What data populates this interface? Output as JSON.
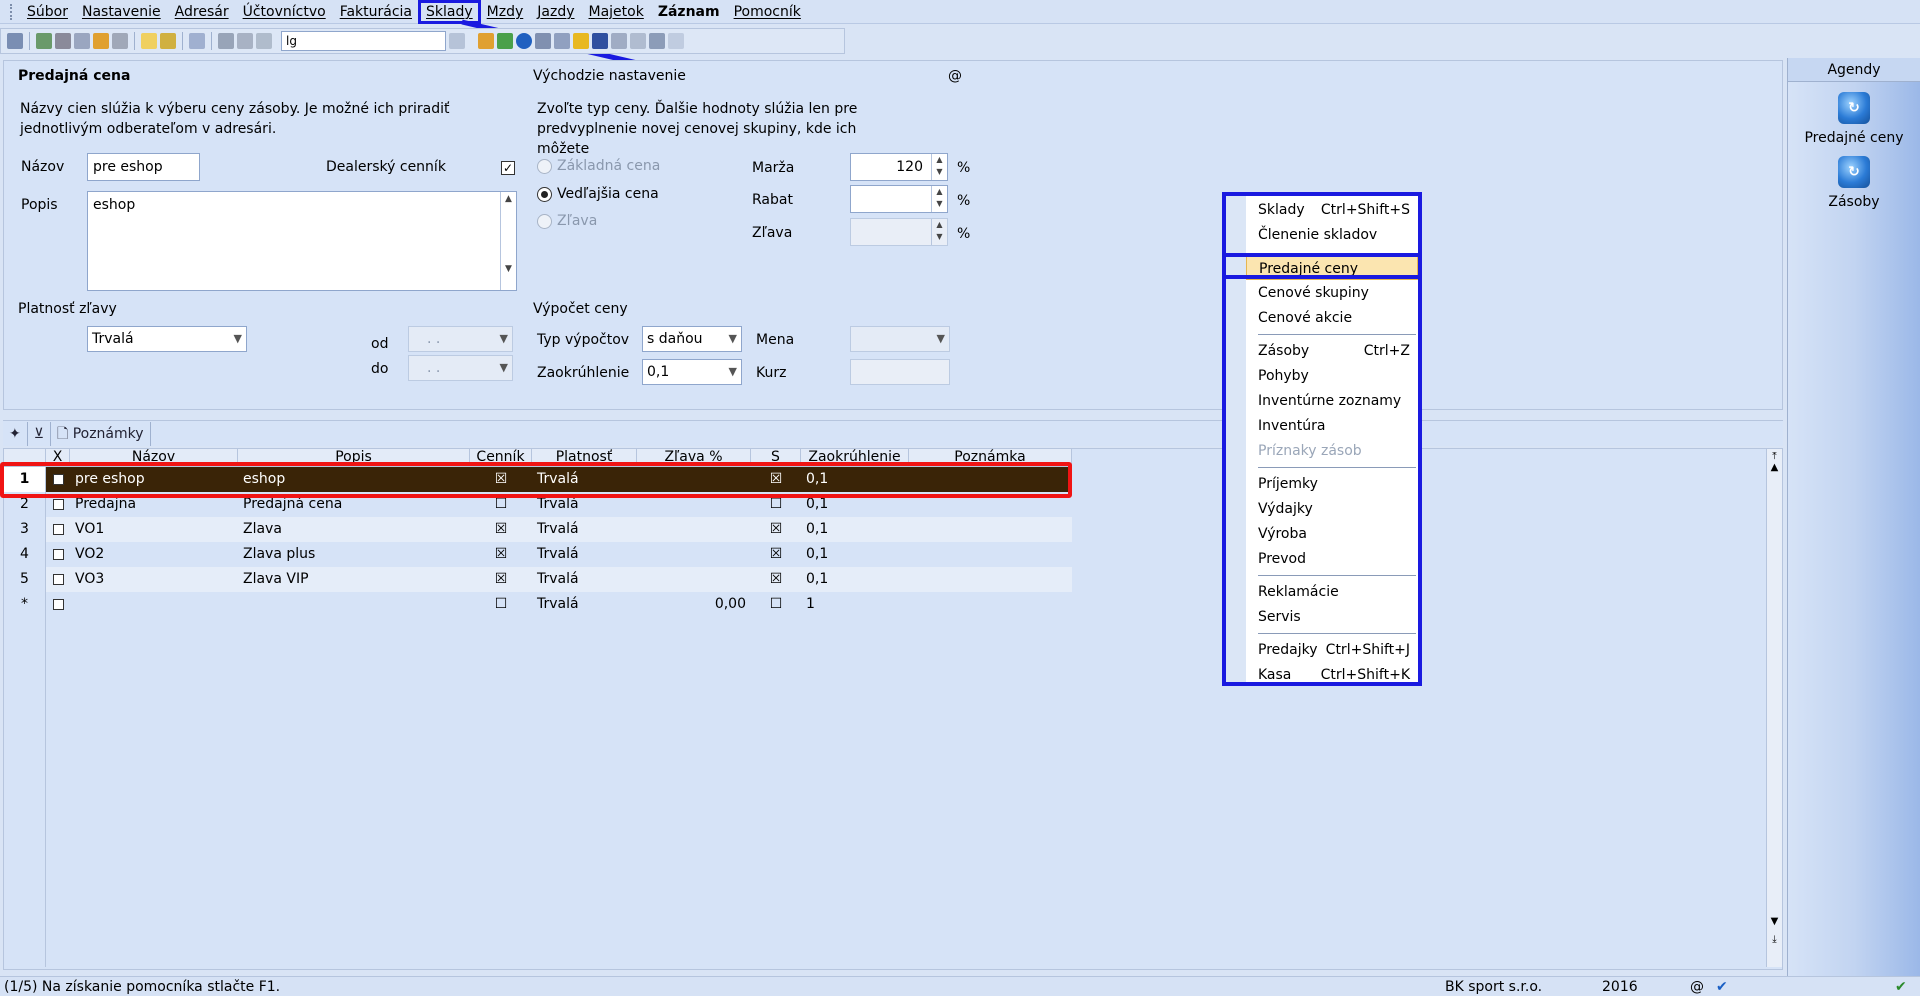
{
  "menu": {
    "items": [
      "Súbor",
      "Nastavenie",
      "Adresár",
      "Účtovníctvo",
      "Fakturácia",
      "Sklady",
      "Mzdy",
      "Jazdy",
      "Majetok",
      "Záznam",
      "Pomocník"
    ],
    "active": "Sklady"
  },
  "toolbar": {
    "search_value": "lg"
  },
  "form": {
    "section_title": "Predajná cena",
    "description": "Názvy cien slúžia k výberu ceny zásoby. Je možné ich priradiť jednotlivým odberateľom v adresári.",
    "name_label": "Názov",
    "name_value": "pre eshop",
    "dealer_label": "Dealerský cenník",
    "dealer_checked": "✓",
    "desc_label": "Popis",
    "desc_value": "eshop",
    "validity_label": "Platnosť zľavy",
    "validity_value": "Trvalá",
    "from_label": "od",
    "to_label": "do",
    "date_placeholder": ". .",
    "defaults_title": "Východzie nastavenie",
    "defaults_text": "Zvoľte typ ceny. Ďalšie hodnoty slúžia len pre predvyplnenie novej cenovej skupiny, kde ich môžete",
    "at_symbol": "@",
    "radio_base": "Základná cena",
    "radio_secondary": "Vedľajšia cena",
    "radio_discount": "Zľava",
    "margin_label": "Marža",
    "margin_value": "120",
    "rabat_label": "Rabat",
    "rabat_value": "",
    "discount_label": "Zľava",
    "percent": "%",
    "calc_title": "Výpočet ceny",
    "calc_type_label": "Typ výpočtov",
    "calc_type_value": "s daňou",
    "rounding_label": "Zaokrúhlenie",
    "rounding_value": "0,1",
    "currency_label": "Mena",
    "rate_label": "Kurz"
  },
  "agenda": {
    "title": "Agendy",
    "items": [
      "Predajné ceny",
      "Zásoby"
    ]
  },
  "tabs": {
    "notes": "Poznámky"
  },
  "grid": {
    "columns": [
      "X",
      "Názov",
      "Popis",
      "Cenník",
      "Platnosť",
      "Zľava %",
      "S",
      "Zaokrúhlenie",
      "Poznámka"
    ],
    "rows": [
      {
        "num": "1",
        "name": "pre eshop",
        "desc": "eshop",
        "pricelist": "☒",
        "validity": "Trvalá",
        "discount": "",
        "s": "☒",
        "rounding": "0,1"
      },
      {
        "num": "2",
        "name": "Predajna",
        "desc": "Predajná cena",
        "pricelist": "☐",
        "validity": "Trvalá",
        "discount": "",
        "s": "☐",
        "rounding": "0,1"
      },
      {
        "num": "3",
        "name": "VO1",
        "desc": "Zlava",
        "pricelist": "☒",
        "validity": "Trvalá",
        "discount": "",
        "s": "☒",
        "rounding": "0,1"
      },
      {
        "num": "4",
        "name": "VO2",
        "desc": "Zlava plus",
        "pricelist": "☒",
        "validity": "Trvalá",
        "discount": "",
        "s": "☒",
        "rounding": "0,1"
      },
      {
        "num": "5",
        "name": "VO3",
        "desc": "Zlava VIP",
        "pricelist": "☒",
        "validity": "Trvalá",
        "discount": "",
        "s": "☒",
        "rounding": "0,1"
      },
      {
        "num": "*",
        "name": "",
        "desc": "",
        "pricelist": "☐",
        "validity": "Trvalá",
        "discount": "0,00",
        "s": "☐",
        "rounding": "1"
      }
    ]
  },
  "context_menu": {
    "items": [
      {
        "label": "Sklady",
        "shortcut": "Ctrl+Shift+S"
      },
      {
        "label": "Členenie skladov",
        "shortcut": ""
      },
      {
        "label": "Predajné ceny",
        "shortcut": ""
      },
      {
        "label": "Cenové skupiny",
        "shortcut": ""
      },
      {
        "label": "Cenové akcie",
        "shortcut": ""
      },
      {
        "label": "Zásoby",
        "shortcut": "Ctrl+Z"
      },
      {
        "label": "Pohyby",
        "shortcut": ""
      },
      {
        "label": "Inventúrne zoznamy",
        "shortcut": ""
      },
      {
        "label": "Inventúra",
        "shortcut": ""
      },
      {
        "label": "Príznaky zásob",
        "shortcut": ""
      },
      {
        "label": "Príjemky",
        "shortcut": ""
      },
      {
        "label": "Výdajky",
        "shortcut": ""
      },
      {
        "label": "Výroba",
        "shortcut": ""
      },
      {
        "label": "Prevod",
        "shortcut": ""
      },
      {
        "label": "Reklamácie",
        "shortcut": ""
      },
      {
        "label": "Servis",
        "shortcut": ""
      },
      {
        "label": "Predajky",
        "shortcut": "Ctrl+Shift+J"
      },
      {
        "label": "Kasa",
        "shortcut": "Ctrl+Shift+K"
      }
    ]
  },
  "status": {
    "hint": "(1/5) Na získanie pomocníka stlačte F1.",
    "company": "BK sport  s.r.o.",
    "year": "2016",
    "at": "@"
  },
  "colors": {
    "highlight_frame": "#1a1ae0",
    "selected_row_frame": "#f01414",
    "selected_row_bg": "#3a2407"
  }
}
